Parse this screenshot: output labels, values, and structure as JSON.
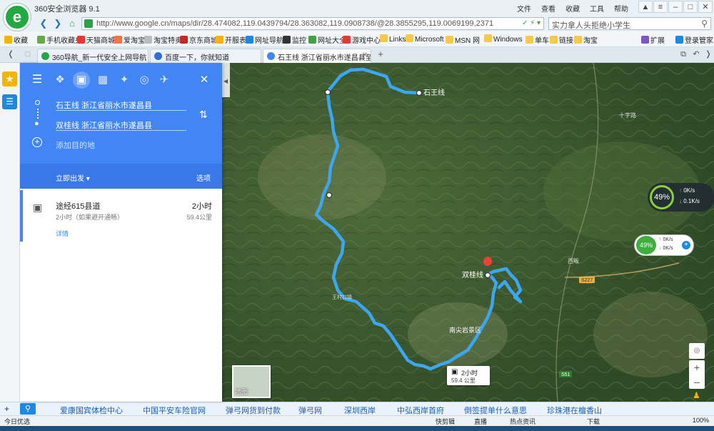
{
  "browser": {
    "title": "360安全浏览器 9.1",
    "logo_letter": "e",
    "top_menu": [
      "文件",
      "查看",
      "收藏",
      "工具",
      "帮助"
    ],
    "url": "http://www.google.cn/maps/dir/28.474082,119.0439794/28.363082,119.0908738/@28.3855295,119.0069199,2371",
    "search_text": "实力拿人头拒绝小学生",
    "bookmarks": [
      "收藏",
      "手机收藏夹",
      "天猫商城",
      "爱淘宝",
      "淘宝特卖",
      "京东商城",
      "开服表",
      "网址导航",
      "监控",
      "网址大全",
      "游戏中心",
      "Links",
      "Microsoft",
      "MSN 网",
      "Windows",
      "单车",
      "链接",
      "淘宝",
      "扩展",
      "登录管家"
    ],
    "tabs": [
      {
        "label": "360导航_新一代安全上网导航",
        "active": false
      },
      {
        "label": "百度一下，你就知道",
        "active": false
      },
      {
        "label": "石王线 浙江省丽水市遂昌县至双",
        "active": true
      }
    ]
  },
  "directions": {
    "origin": "石王线 浙江省丽水市遂昌县",
    "destination": "双桂线 浙江省丽水市遂昌县",
    "add_destination": "添加目的地",
    "depart_now": "立即出发",
    "options": "选项",
    "route_name": "途经615县道",
    "route_time": "2小时",
    "route_note": "2小时（如果避开通畅）",
    "route_distance": "59.4公里",
    "details": "详情"
  },
  "map": {
    "start_label": "石王线",
    "end_label": "双桂线",
    "callout_time": "2小时",
    "callout_distance": "59.4 公里",
    "scenic_label": "南尖岩景区",
    "road_labels": [
      "S227",
      "S51"
    ],
    "village_labels": [
      "十字路",
      "王村口镇",
      "西畈",
      "三仁"
    ],
    "layer_label": "地图",
    "accent_color": "#3ca6f0",
    "pin_color": "#ea4335"
  },
  "net_widget": {
    "percent": "49%",
    "up": "0K/s",
    "down": "0.1K/s"
  },
  "net_widget2": {
    "percent": "49%",
    "up": "0K/s",
    "down": "0K/s"
  },
  "hot_search": [
    "爱康国宾体检中心",
    "中国平安车险官网",
    "弹弓网货到付款",
    "弹弓网",
    "深圳西岸",
    "中弘西岸首府",
    "倒签提单什么意思",
    "珍珠港在檀香山"
  ],
  "status": {
    "left": "今日优选",
    "items": [
      "快剪辑",
      "直播",
      "热点资讯",
      "下载"
    ],
    "zoom": "100%"
  }
}
